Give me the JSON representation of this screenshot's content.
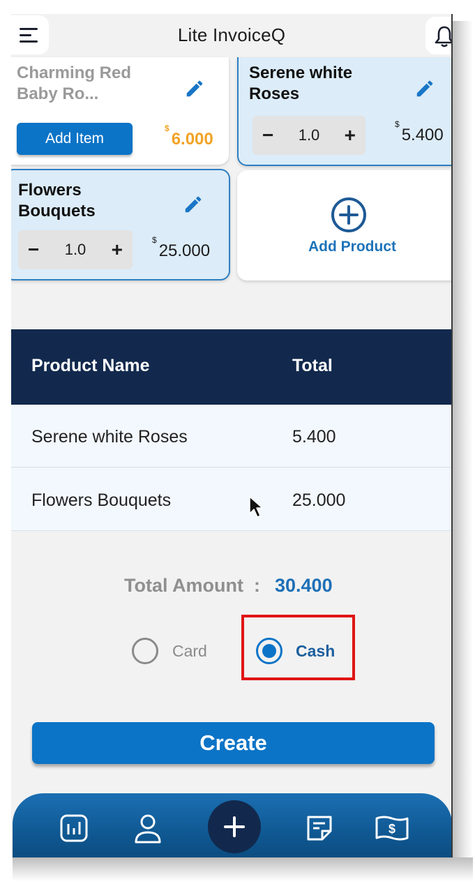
{
  "header": {
    "title": "Lite InvoiceQ",
    "menu_icon": "menu-icon",
    "bell_icon": "bell-icon"
  },
  "products": [
    {
      "name_line1": "Charming Red",
      "name_line2": "Baby Ro...",
      "action": "Add Item",
      "currency": "$",
      "price": "6.000",
      "selected": false
    },
    {
      "name_line1": "Serene white",
      "name_line2": "Roses",
      "quantity": "1.0",
      "currency": "$",
      "price": "5.400",
      "selected": true
    },
    {
      "name_line1": "Flowers",
      "name_line2": "Bouquets",
      "quantity": "1.0",
      "currency": "$",
      "price": "25.000",
      "selected": true
    }
  ],
  "add_product": {
    "label": "Add Product",
    "icon": "plus-circle-icon"
  },
  "table": {
    "columns": [
      "Product Name",
      "Total"
    ],
    "rows": [
      [
        "Serene white Roses",
        "5.400"
      ],
      [
        "Flowers Bouquets",
        "25.000"
      ]
    ]
  },
  "total": {
    "label": "Total Amount",
    "separator": ":",
    "value": "30.400"
  },
  "payment": {
    "options": [
      "Card",
      "Cash"
    ],
    "selected": "Cash"
  },
  "create_button": {
    "label": "Create"
  },
  "bottom_nav": {
    "items": [
      "chart-icon",
      "user-icon",
      "add-icon",
      "note-icon",
      "money-icon"
    ]
  },
  "colors": {
    "primary": "#0b74c7",
    "navy": "#12294d",
    "accent_orange": "#f2a326",
    "highlight_red": "#e01515"
  }
}
